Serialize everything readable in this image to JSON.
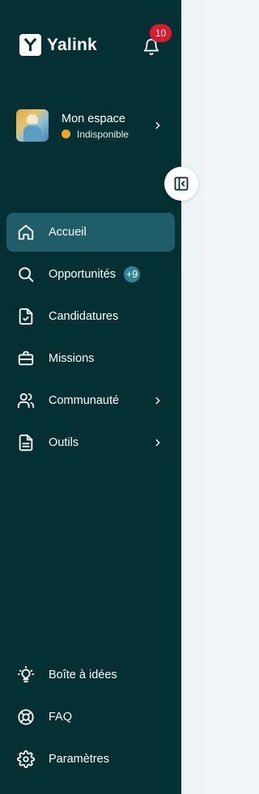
{
  "brand": {
    "name": "Yalink",
    "logo_letter": "Y"
  },
  "notifications": {
    "count": "10"
  },
  "profile": {
    "name": "Mon espace",
    "status": "Indisponible",
    "status_color": "#f4a32a"
  },
  "nav": {
    "items": [
      {
        "label": "Accueil",
        "icon": "home-icon",
        "active": true
      },
      {
        "label": "Opportunités",
        "icon": "search-icon",
        "badge": "+9"
      },
      {
        "label": "Candidatures",
        "icon": "file-check-icon"
      },
      {
        "label": "Missions",
        "icon": "briefcase-icon"
      },
      {
        "label": "Communauté",
        "icon": "users-icon",
        "has_submenu": true
      },
      {
        "label": "Outils",
        "icon": "file-text-icon",
        "has_submenu": true
      }
    ],
    "footer_items": [
      {
        "label": "Boîte à idées",
        "icon": "lightbulb-icon"
      },
      {
        "label": "FAQ",
        "icon": "lifebuoy-icon"
      },
      {
        "label": "Paramètres",
        "icon": "gear-icon"
      }
    ]
  },
  "colors": {
    "sidebar_bg": "#042f33",
    "active_bg": "#1f5e68",
    "badge_bg": "#2b8594",
    "notification_badge": "#dc1b2c"
  }
}
